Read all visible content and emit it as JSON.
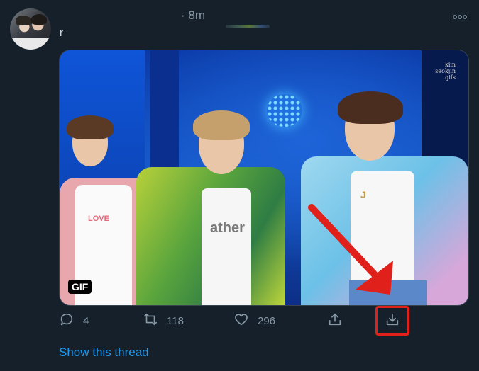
{
  "tweet": {
    "handle_fragment": "r",
    "time": "· 8m",
    "more_glyph": "ooo"
  },
  "media": {
    "badge": "GIF",
    "watermark": [
      "kim",
      "seokjin",
      "gifs"
    ],
    "shirt_text": "LOVE",
    "shirt_text_2": "ather",
    "shirt_text_3": "J"
  },
  "actions": {
    "reply_count": "4",
    "retweet_count": "118",
    "like_count": "296"
  },
  "links": {
    "show_thread": "Show this thread"
  },
  "colors": {
    "background": "#15202b",
    "muted": "#8899a6",
    "link": "#1d9bf0",
    "highlight": "#e0201a"
  },
  "icons": [
    "reply-icon",
    "retweet-icon",
    "like-icon",
    "share-icon",
    "download-icon",
    "more-icon"
  ]
}
